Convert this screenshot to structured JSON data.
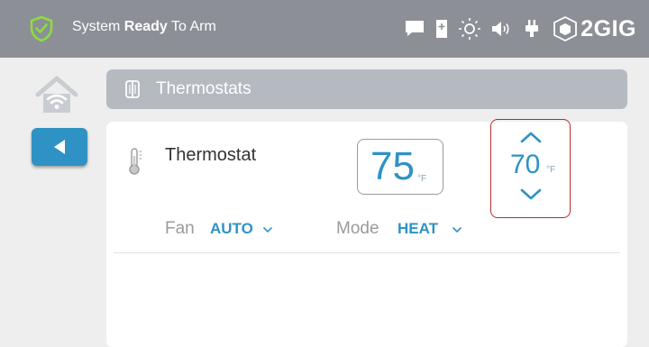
{
  "status_bar": {
    "status_prefix": "System",
    "status_bold": "Ready",
    "status_suffix": "To Arm",
    "brand": "2GIG",
    "icons": [
      "shield-check-icon",
      "message-icon",
      "bookmark-icon",
      "brightness-icon",
      "volume-icon",
      "plug-icon",
      "2gig-cube-logo-icon"
    ]
  },
  "nav": {
    "home_icon": "home-wifi-icon",
    "back_icon": "back-arrow-icon"
  },
  "title_bar": {
    "title": "Thermostats",
    "icon": "thermostat-device-icon"
  },
  "thermostat": {
    "name": "Thermostat",
    "current_temp": "75",
    "current_unit": "°F",
    "setpoint_temp": "70",
    "setpoint_unit": "°F",
    "fan_label": "Fan",
    "fan_value": "AUTO",
    "mode_label": "Mode",
    "mode_value": "HEAT"
  },
  "colors": {
    "accent": "#2e93c4",
    "status_bar": "#8c9096",
    "title_bar": "#b4bac0",
    "setpoint_border": "#b72a2e"
  }
}
